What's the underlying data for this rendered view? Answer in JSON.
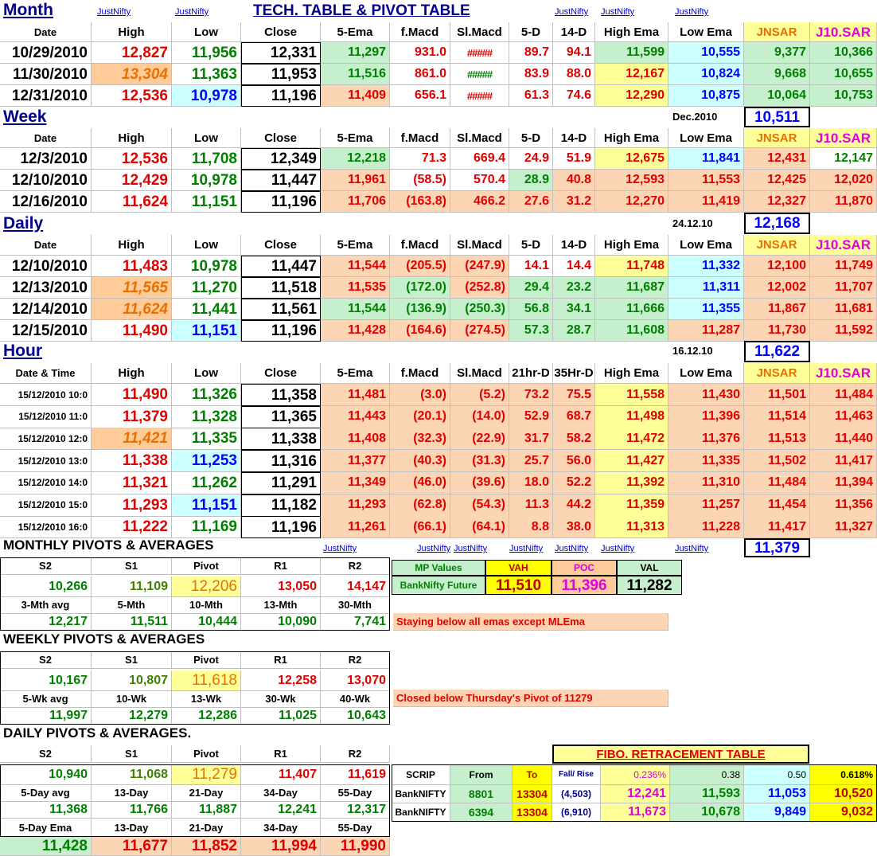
{
  "title": "TECH. TABLE  &  PIVOT TABLE",
  "link": "JustNifty",
  "col_headers": {
    "date": "Date",
    "high": "High",
    "low": "Low",
    "close": "Close",
    "ema5": "5-Ema",
    "fmacd": "f.Macd",
    "slmacd": "Sl.Macd",
    "d5": "5-D",
    "d14": "14-D",
    "hiema": "High Ema",
    "loema": "Low Ema",
    "jnsar": "JNSAR",
    "j10sar": "J10.SAR"
  },
  "month": {
    "label": "Month",
    "rows": [
      [
        "10/29/2010",
        "12,827",
        "11,956",
        "12,331",
        "11,297",
        "931.0",
        "#####",
        "89.7",
        "94.1",
        "11,599",
        "10,555",
        "9,377",
        "10,366"
      ],
      [
        "11/30/2010",
        "13,304",
        "11,363",
        "11,953",
        "11,516",
        "861.0",
        "#####",
        "83.9",
        "88.0",
        "12,167",
        "10,824",
        "9,668",
        "10,655"
      ],
      [
        "12/31/2010",
        "12,536",
        "10,978",
        "11,196",
        "11,409",
        "656.1",
        "#####",
        "61.3",
        "74.6",
        "12,290",
        "10,875",
        "10,064",
        "10,753"
      ]
    ]
  },
  "week": {
    "label": "Week",
    "period_label": "Dec.2010",
    "period_value": "10,511",
    "rows": [
      [
        "12/3/2010",
        "12,536",
        "11,708",
        "12,349",
        "12,218",
        "71.3",
        "669.4",
        "24.9",
        "51.9",
        "12,675",
        "11,841",
        "12,431",
        "12,147"
      ],
      [
        "12/10/2010",
        "12,429",
        "10,978",
        "11,447",
        "11,961",
        "(58.5)",
        "570.4",
        "28.9",
        "40.8",
        "12,593",
        "11,553",
        "12,425",
        "12,020"
      ],
      [
        "12/16/2010",
        "11,624",
        "11,151",
        "11,196",
        "11,706",
        "(163.8)",
        "466.2",
        "27.6",
        "31.2",
        "12,270",
        "11,419",
        "12,327",
        "11,870"
      ]
    ]
  },
  "daily": {
    "label": "Daily",
    "period_label": "24.12.10",
    "period_value": "12,168",
    "rows": [
      [
        "12/10/2010",
        "11,483",
        "10,978",
        "11,447",
        "11,544",
        "(205.5)",
        "(247.9)",
        "14.1",
        "14.4",
        "11,748",
        "11,332",
        "12,100",
        "11,749"
      ],
      [
        "12/13/2010",
        "11,565",
        "11,270",
        "11,518",
        "11,535",
        "(172.0)",
        "(252.8)",
        "29.4",
        "23.2",
        "11,687",
        "11,311",
        "12,002",
        "11,707"
      ],
      [
        "12/14/2010",
        "11,624",
        "11,441",
        "11,561",
        "11,544",
        "(136.9)",
        "(250.3)",
        "56.8",
        "34.1",
        "11,666",
        "11,355",
        "11,867",
        "11,681"
      ],
      [
        "12/15/2010",
        "11,490",
        "11,151",
        "11,196",
        "11,428",
        "(164.6)",
        "(274.5)",
        "57.3",
        "28.7",
        "11,608",
        "11,287",
        "11,730",
        "11,592"
      ]
    ]
  },
  "hour": {
    "label": "Hour",
    "period_label": "16.12.10",
    "period_value": "11,622",
    "date_header": "Date & Time",
    "d5": "21hr-D",
    "d14": "35Hr-D",
    "bottom_value": "11,379",
    "rows": [
      [
        "15/12/2010 10:0",
        "11,490",
        "11,326",
        "11,358",
        "11,481",
        "(3.0)",
        "(5.2)",
        "73.2",
        "75.5",
        "11,558",
        "11,430",
        "11,501",
        "11,484"
      ],
      [
        "15/12/2010 11:0",
        "11,379",
        "11,328",
        "11,365",
        "11,443",
        "(20.1)",
        "(14.0)",
        "52.9",
        "68.7",
        "11,498",
        "11,396",
        "11,514",
        "11,463"
      ],
      [
        "15/12/2010 12:0",
        "11,421",
        "11,335",
        "11,338",
        "11,408",
        "(32.3)",
        "(22.9)",
        "31.7",
        "58.2",
        "11,472",
        "11,376",
        "11,513",
        "11,440"
      ],
      [
        "15/12/2010 13:0",
        "11,338",
        "11,253",
        "11,316",
        "11,377",
        "(40.3)",
        "(31.3)",
        "25.7",
        "56.0",
        "11,427",
        "11,335",
        "11,502",
        "11,417"
      ],
      [
        "15/12/2010 14:0",
        "11,321",
        "11,262",
        "11,291",
        "11,349",
        "(46.0)",
        "(39.6)",
        "18.0",
        "52.2",
        "11,392",
        "11,310",
        "11,484",
        "11,394"
      ],
      [
        "15/12/2010 15:0",
        "11,293",
        "11,151",
        "11,182",
        "11,293",
        "(62.8)",
        "(54.3)",
        "11.3",
        "44.2",
        "11,359",
        "11,257",
        "11,454",
        "11,356"
      ],
      [
        "15/12/2010 16:0",
        "11,222",
        "11,169",
        "11,196",
        "11,261",
        "(66.1)",
        "(64.1)",
        "8.8",
        "38.0",
        "11,313",
        "11,228",
        "11,417",
        "11,327"
      ]
    ]
  },
  "monthly_pivots": {
    "title": "MONTHLY  PIVOTS  &  AVERAGES",
    "h": [
      "S2",
      "S1",
      "Pivot",
      "R1",
      "R2"
    ],
    "v": [
      "10,266",
      "11,109",
      "12,206",
      "13,050",
      "14,147"
    ],
    "ah": [
      "3-Mth avg",
      "5-Mth",
      "10-Mth",
      "13-Mth",
      "30-Mth"
    ],
    "av": [
      "12,217",
      "11,511",
      "10,444",
      "10,090",
      "7,741"
    ],
    "note": "Staying below all emas except MLEma"
  },
  "weekly_pivots": {
    "title": "WEEKLY  PIVOTS  &  AVERAGES",
    "h": [
      "S2",
      "S1",
      "Pivot",
      "R1",
      "R2"
    ],
    "v": [
      "10,167",
      "10,807",
      "11,618",
      "12,258",
      "13,070"
    ],
    "ah": [
      "5-Wk avg",
      "10-Wk",
      "13-Wk",
      "30-Wk",
      "40-Wk"
    ],
    "av": [
      "11,997",
      "12,279",
      "12,286",
      "11,025",
      "10,643"
    ],
    "note": "Closed below Thursday's Pivot of 11279"
  },
  "daily_pivots": {
    "title": "DAILY  PIVOTS  &  AVERAGES.",
    "h": [
      "S2",
      "S1",
      "Pivot",
      "R1",
      "R2"
    ],
    "v": [
      "10,940",
      "11,068",
      "11,279",
      "11,407",
      "11,619"
    ],
    "ah": [
      "5-Day avg",
      "13-Day",
      "21-Day",
      "34-Day",
      "55-Day"
    ],
    "av": [
      "11,368",
      "11,766",
      "11,887",
      "12,241",
      "12,317"
    ],
    "eh": [
      "5-Day Ema",
      "13-Day",
      "21-Day",
      "34-Day",
      "55-Day"
    ],
    "ev": [
      "11,428",
      "11,677",
      "11,852",
      "11,994",
      "11,990"
    ]
  },
  "mp": {
    "label": "MP Values",
    "vah": "VAH",
    "poc": "POC",
    "val": "VAL",
    "scrip": "BankNifty Future",
    "vah_v": "11,510",
    "poc_v": "11,396",
    "val_v": "11,282"
  },
  "fibo": {
    "title": "FIBO. RETRACEMENT TABLE",
    "h": [
      "SCRIP",
      "From",
      "To",
      "Fall/ Rise",
      "0.236%",
      "0.38",
      "0.50",
      "0.618%"
    ],
    "rows": [
      [
        "BankNIFTY",
        "8801",
        "13304",
        "(4,503)",
        "12,241",
        "11,593",
        "11,053",
        "10,520"
      ],
      [
        "BankNIFTY",
        "6394",
        "13304",
        "(6,910)",
        "11,673",
        "10,678",
        "9,849",
        "9,032"
      ]
    ]
  }
}
